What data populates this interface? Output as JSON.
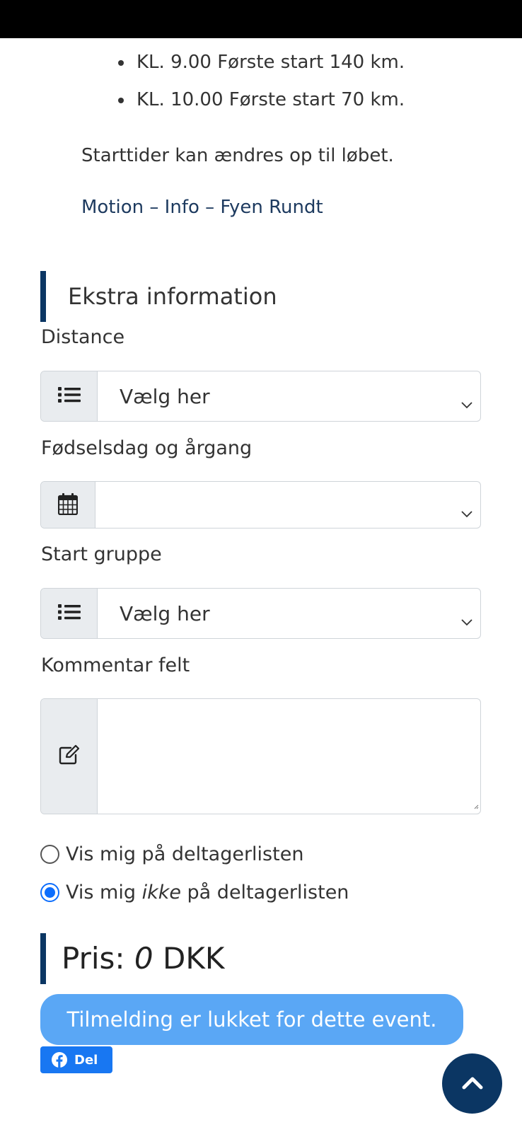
{
  "start_times": [
    "KL. 9.00 Første start 140 km.",
    "KL. 10.00 Første start 70 km."
  ],
  "note": "Starttider kan ændres op til løbet.",
  "info_link": "Motion – Info – Fyen Rundt",
  "extra_section": {
    "title": "Ekstra information",
    "distance": {
      "label": "Distance",
      "value": "Vælg her",
      "icon": "list-icon"
    },
    "birthday": {
      "label": "Fødselsdag og årgang",
      "value": "",
      "icon": "calendar-icon"
    },
    "start_group": {
      "label": "Start gruppe",
      "value": "Vælg her",
      "icon": "list-icon"
    },
    "comment": {
      "label": "Kommentar felt",
      "value": "",
      "icon": "edit-icon"
    }
  },
  "participant_list": {
    "options": [
      {
        "before": "Vis mig på deltagerlisten",
        "emphasis": "",
        "after": "",
        "checked": false
      },
      {
        "before": "Vis mig ",
        "emphasis": "ikke",
        "after": " på deltagerlisten",
        "checked": true
      }
    ]
  },
  "price": {
    "prefix": "Pris: ",
    "amount": "0",
    "currency": " DKK"
  },
  "closed_message": "Tilmelding er lukket for dette event.",
  "share_label": "Del",
  "colors": {
    "heading_accent": "#0b3663",
    "link": "#1d3a5f",
    "closed_button": "#5aa7f5",
    "facebook": "#1877f2",
    "radio_checked": "#0d6efd",
    "scroll_top_button": "#0b3663"
  }
}
